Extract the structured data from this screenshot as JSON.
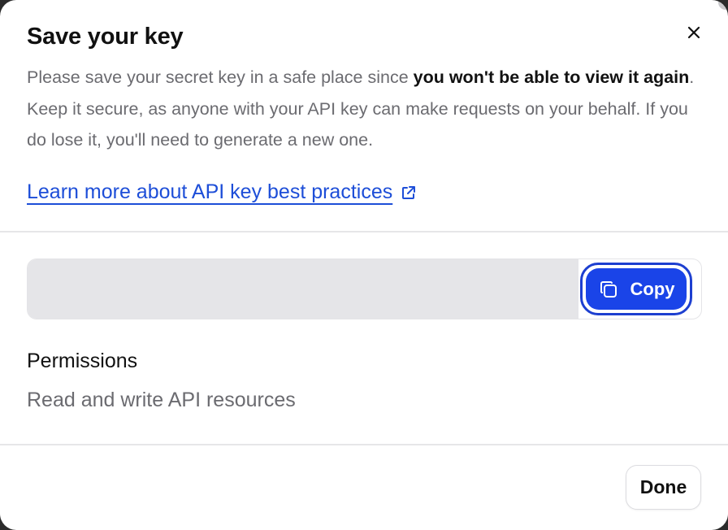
{
  "dialog": {
    "title": "Save your key",
    "description_intro": "Please save your secret key in a safe place since ",
    "description_bold": "you won't be able to view it again",
    "description_rest": ". Keep it secure, as anyone with your API key can make requests on your behalf. If you do lose it, you'll need to generate a new one.",
    "learn_more_link": "Learn more about API key best practices",
    "key_value": "",
    "copy_label": "Copy",
    "permissions_heading": "Permissions",
    "permissions_value": "Read and write API resources",
    "done_label": "Done"
  },
  "icons": {
    "close": "close-icon",
    "external": "external-link-icon",
    "copy": "copy-icon"
  },
  "colors": {
    "accent": "#1a44e8",
    "link": "#1d4ed8",
    "muted_text": "#6b6b70",
    "key_field_bg": "#e5e5e8"
  }
}
